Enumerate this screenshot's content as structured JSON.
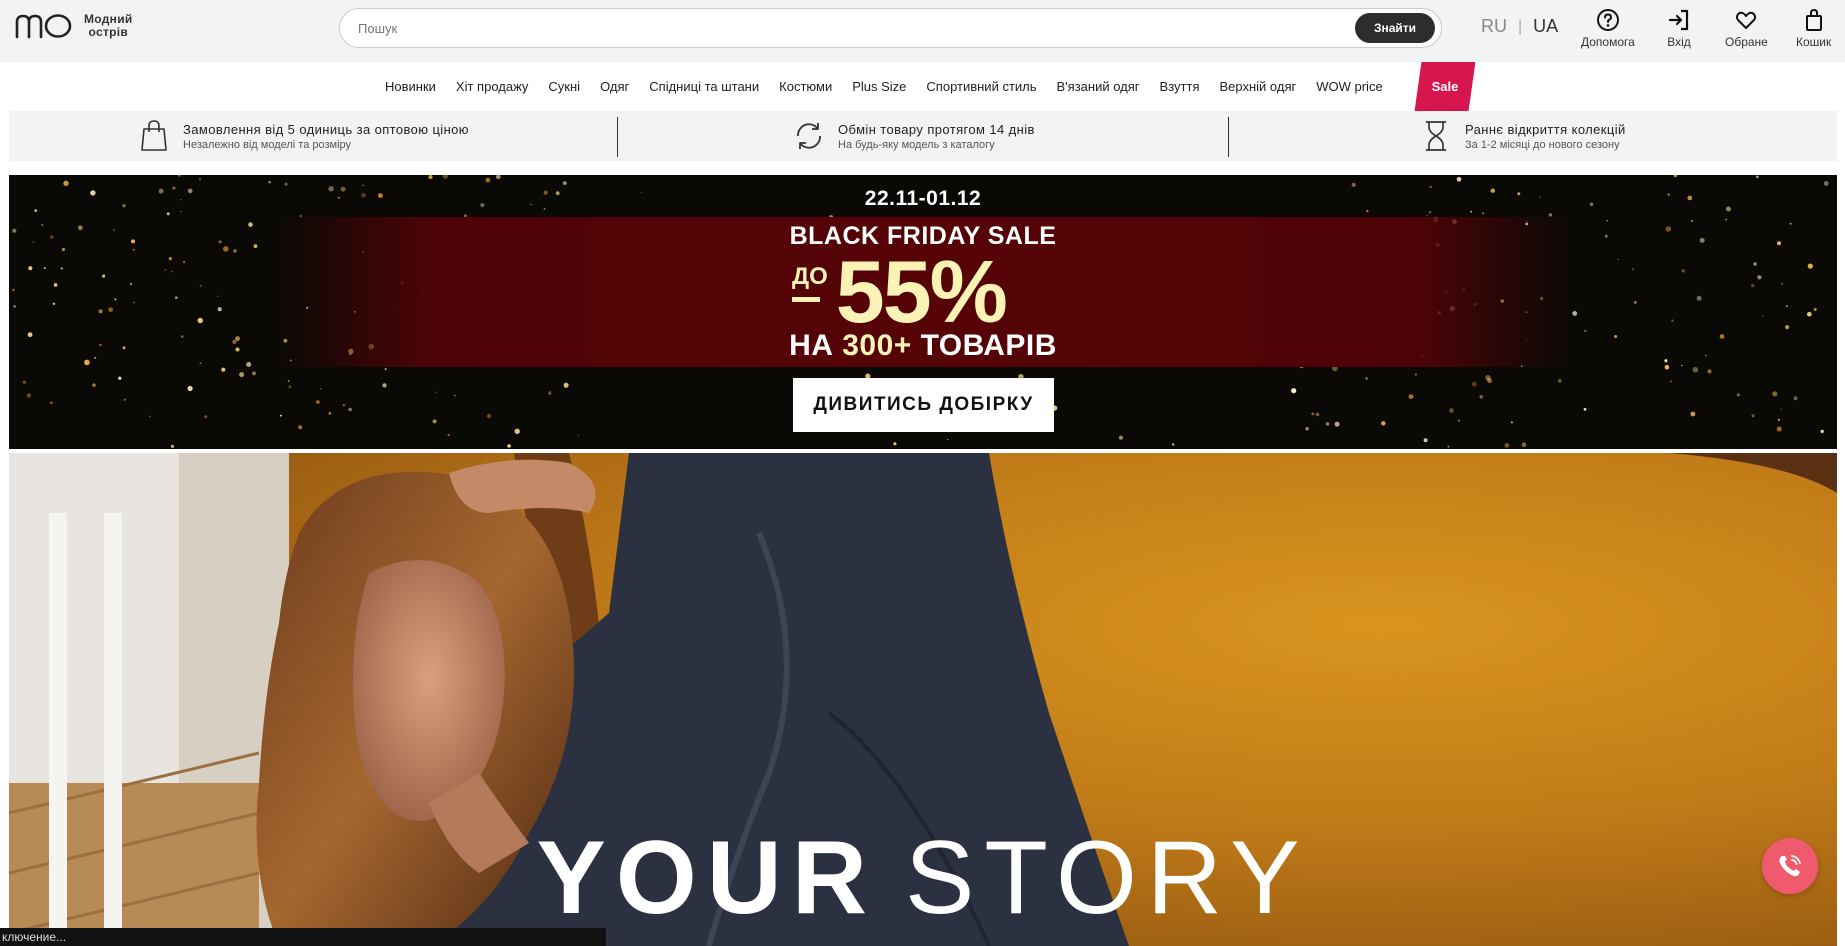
{
  "header": {
    "logo_text_line1": "Модний",
    "logo_text_line2": "острів",
    "search": {
      "placeholder": "Пошук",
      "button_label": "Знайти"
    },
    "languages": [
      {
        "label": "RU",
        "active": false
      },
      {
        "label": "UA",
        "active": true
      }
    ],
    "lang_separator": "|",
    "actions": {
      "help": "Допомога",
      "login": "Вхід",
      "favorites": "Обране",
      "cart": "Кошик"
    }
  },
  "nav": {
    "items": [
      "Новинки",
      "Хіт продажу",
      "Сукні",
      "Одяг",
      "Спідниці та штани",
      "Костюми",
      "Plus Size",
      "Спортивний стиль",
      "В'язаний одяг",
      "Взуття",
      "Верхній одяг",
      "WOW price"
    ],
    "sale_label": "Sale",
    "sale_color": "#d6174f"
  },
  "benefits": [
    {
      "icon": "shopping-bag-icon",
      "title": "Замовлення від 5 одиниць за оптовою ціною",
      "subtitle": "Незалежно від моделі та розміру"
    },
    {
      "icon": "exchange-icon",
      "title": "Обмін товару протягом 14 днів",
      "subtitle": "На будь-яку модель з каталогу"
    },
    {
      "icon": "hourglass-icon",
      "title": "Раннє відкриття колекцій",
      "subtitle": "За 1-2 місяці до нового сезону"
    }
  ],
  "banner": {
    "dates": "22.11-01.12",
    "title": "BLACK FRIDAY SALE",
    "prefix": "ДО",
    "discount": "55%",
    "items_prefix": "НА",
    "items_highlight": "300+",
    "items_suffix": "ТОВАРІВ",
    "cta": "ДИВИТИСЬ ДОБІРКУ",
    "accent_color": "#fbf2b6"
  },
  "hero": {
    "title_bold": "YOUR",
    "title_light": "STORY"
  },
  "status_bar": {
    "text": "ключение..."
  }
}
